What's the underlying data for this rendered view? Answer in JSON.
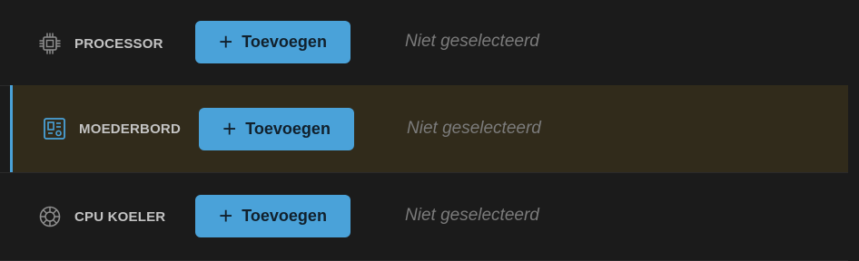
{
  "components": [
    {
      "label": "PROCESSOR",
      "icon": "cpu-chip-icon",
      "button_label": "Toevoegen",
      "button_icon": "plus-icon",
      "status": "Niet geselecteerd",
      "selected": false
    },
    {
      "label": "MOEDERBORD",
      "icon": "motherboard-icon",
      "button_label": "Toevoegen",
      "button_icon": "plus-icon",
      "status": "Niet geselecteerd",
      "selected": true
    },
    {
      "label": "CPU KOELER",
      "icon": "cooler-fan-icon",
      "button_label": "Toevoegen",
      "button_icon": "plus-icon",
      "status": "Niet geselecteerd",
      "selected": false
    }
  ],
  "colors": {
    "background": "#1b1b1b",
    "highlight_row": "#312b1b",
    "accent": "#4aa2d9",
    "label_text": "#c3c3c3",
    "status_text": "#7b7b7b"
  }
}
